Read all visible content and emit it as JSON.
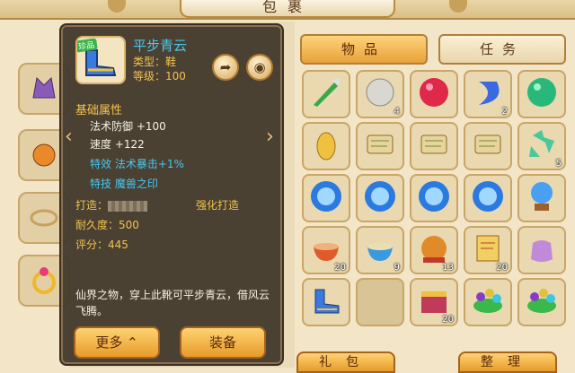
{
  "window": {
    "title": "包裹"
  },
  "tabs": [
    {
      "label": "物品",
      "active": true
    },
    {
      "label": "任务",
      "active": false
    }
  ],
  "tooltip": {
    "badge": "珍品",
    "name": "平步青云",
    "type": "类型：鞋",
    "level": "等级：100",
    "section_title": "基础属性",
    "stats": [
      {
        "label": "法术防御 +100"
      },
      {
        "label": "速度 +122"
      }
    ],
    "effect": "特效  法术暴击+1%",
    "skill": "特技  魔兽之印",
    "forge_label": "打造：",
    "forge_status": "强化打造",
    "durability": "耐久度：500",
    "score": "评分：445",
    "description": "仙界之物，穿上此靴可平步青云，借风云飞腾。",
    "more_button": "更多",
    "equip_button": "装备"
  },
  "inventory": [
    {
      "item": "weapon",
      "count": ""
    },
    {
      "item": "shell",
      "count": "4"
    },
    {
      "item": "red-orb",
      "count": ""
    },
    {
      "item": "moon-gem",
      "count": "2"
    },
    {
      "item": "green-orb",
      "count": ""
    },
    {
      "item": "gold-ingot",
      "count": ""
    },
    {
      "item": "scroll",
      "count": ""
    },
    {
      "item": "scroll",
      "count": ""
    },
    {
      "item": "scroll",
      "count": ""
    },
    {
      "item": "green-crystal",
      "count": "5"
    },
    {
      "item": "blue-orb",
      "count": ""
    },
    {
      "item": "blue-orb",
      "count": ""
    },
    {
      "item": "blue-orb",
      "count": ""
    },
    {
      "item": "blue-orb",
      "count": ""
    },
    {
      "item": "blue-sphere",
      "count": ""
    },
    {
      "item": "soup-bowl",
      "count": "20"
    },
    {
      "item": "noodle-bowl",
      "count": "9"
    },
    {
      "item": "lantern",
      "count": "13"
    },
    {
      "item": "scroll-gold",
      "count": "20"
    },
    {
      "item": "pouch",
      "count": ""
    },
    {
      "item": "boots",
      "count": ""
    },
    {
      "item": "empty",
      "count": ""
    },
    {
      "item": "chest",
      "count": "20"
    },
    {
      "item": "beads-leaf",
      "count": ""
    },
    {
      "item": "beads-leaf",
      "count": ""
    }
  ],
  "bottom": {
    "gift": "礼包",
    "sort": "整理"
  },
  "colors": {
    "panel": "#44392e",
    "accent": "#f2c24d",
    "cyan": "#46c8f0"
  }
}
